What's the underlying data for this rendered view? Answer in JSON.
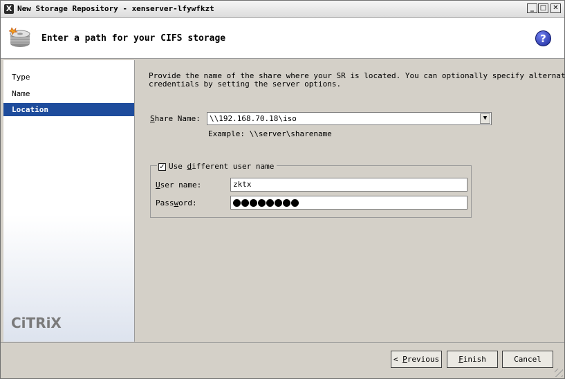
{
  "window": {
    "title": "New Storage Repository - xenserver-lfywfkzt",
    "app_icon": "x-icon",
    "controls": {
      "minimize": "_",
      "maximize": "□",
      "close": "✕"
    }
  },
  "header": {
    "icon": "storage-disk-icon",
    "title": "Enter a path for your CIFS storage",
    "help_icon": "?"
  },
  "sidebar": {
    "items": [
      {
        "label": "Type",
        "active": false
      },
      {
        "label": "Name",
        "active": false
      },
      {
        "label": "Location",
        "active": true
      }
    ],
    "logo": "CiTRiX"
  },
  "main": {
    "description": "Provide the name of the share where your SR is located. You can optionally specify alternative\ncredentials by setting the server options.",
    "share_name": {
      "label_prefix": "S",
      "label_rest": "hare Name:",
      "value": "\\\\192.168.70.18\\iso",
      "example": "Example: \\\\server\\sharename"
    },
    "credentials": {
      "checkbox_checked": true,
      "checkbox_mark": "✓",
      "legend_pre": "Use ",
      "legend_ul": "d",
      "legend_post": "ifferent user name",
      "username_label_ul": "U",
      "username_label_rest": "ser name:",
      "username_value": "zktx",
      "password_label_pre": "Pass",
      "password_label_ul": "w",
      "password_label_post": "ord:",
      "password_length": 8
    }
  },
  "footer": {
    "previous_arrow": "<",
    "previous_ul": "P",
    "previous_rest": "revious",
    "finish_ul": "F",
    "finish_rest": "inish",
    "cancel": "Cancel"
  }
}
